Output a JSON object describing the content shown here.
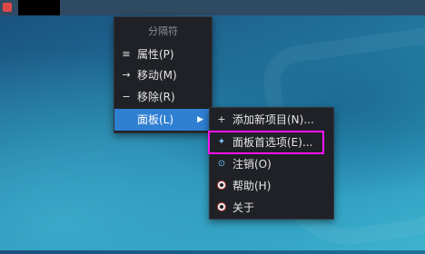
{
  "context_menu": {
    "header": "分隔符",
    "items": [
      {
        "icon": "≡",
        "label": "属性(P)"
      },
      {
        "icon": "→",
        "label": "移动(M)"
      },
      {
        "icon": "−",
        "label": "移除(R)"
      },
      {
        "icon": "",
        "label": "面板(L)",
        "arrow": "▶"
      }
    ]
  },
  "panel_submenu": {
    "items": [
      {
        "icon": "+",
        "label": "添加新项目(N)..."
      },
      {
        "icon": "✦",
        "label": "面板首选项(E)..."
      },
      {
        "icon": "⊙",
        "label": "注销(O)"
      },
      {
        "icon": "",
        "label": "帮助(H)"
      },
      {
        "icon": "",
        "label": "关于"
      }
    ]
  },
  "colors": {
    "highlight": "#ff14f0",
    "active_item": "#2f7fd2"
  }
}
